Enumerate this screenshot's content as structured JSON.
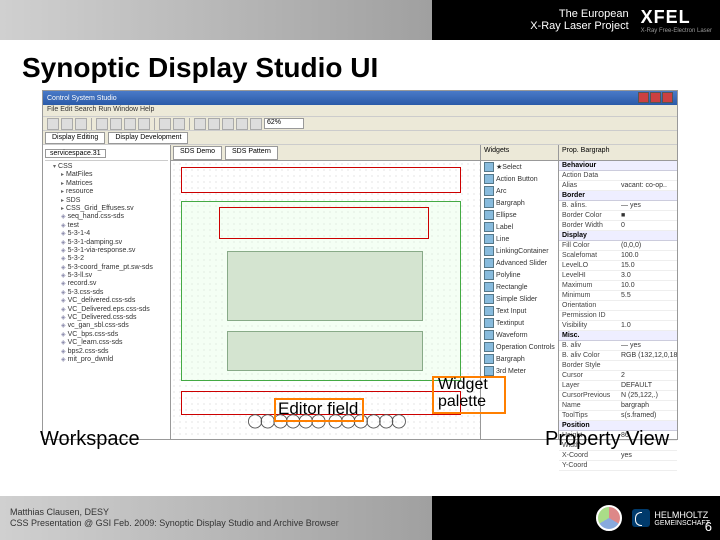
{
  "header": {
    "line1": "The European",
    "line2": "X-Ray Laser Project",
    "brand": "XFEL",
    "brand_sub": "X-Ray Free-Electron Laser"
  },
  "title": "Synoptic Display Studio UI",
  "app": {
    "window_title": "Control System Studio",
    "menu": "File  Edit  Search  Run  Window  Help",
    "zoom": "62%",
    "fs_tab1": "Display Editing",
    "fs_tab2": "Display Development",
    "editor_tab": "servicespace.31",
    "canvas_tab1": "SDS Demo",
    "canvas_tab2": "SDS Pattern"
  },
  "tree": {
    "root": "CSS",
    "items": [
      "MatFiles",
      "Matrices",
      "resource",
      "SDS",
      "CSS_Grid_Effuses.sv",
      "seq_hand.css-sds",
      "test",
      "5-3-1-4",
      "5-3-1-damping.sv",
      "5-3-1-via-response.sv",
      "5-3-2",
      "5-3-coord_frame_pt.sw-sds",
      "5-3-ll.sv",
      "record.sv",
      "5-3.css-sds",
      "VC_delivered.css-sds",
      "VC_Delivered.eps.css-sds",
      "VC_Delivered.css-sds",
      "vc_gan_sbl.css-sds",
      "VC_bps.css-sds",
      "VC_learn.css-sds",
      "bps2.css-sds",
      "mit_pro_dwnld"
    ]
  },
  "palette": {
    "title": "Widgets",
    "items": [
      "★Select",
      "Action Button",
      "Arc",
      "Bargraph",
      "Ellipse",
      "Label",
      "Line",
      "LinkingContainer",
      "Advanced Slider",
      "Polyline",
      "Rectangle",
      "Simple Slider",
      "Text Input",
      "Textinput",
      "Waveform",
      "Operation Controls",
      "Bargraph",
      "3rd Meter"
    ]
  },
  "props": {
    "title": "Prop. Bargraph",
    "sections": {
      "behaviour": [
        [
          "Action Data",
          ""
        ],
        [
          "Alias",
          "vacant: co-op.."
        ]
      ],
      "border": [
        [
          "B. alins.",
          "— yes"
        ],
        [
          "Border Color",
          "■"
        ],
        [
          "Border Width",
          "0"
        ]
      ],
      "display": [
        [
          "Fill Color",
          "(0,0,0)"
        ],
        [
          "Scalefomat",
          "100.0"
        ],
        [
          "LevelLO",
          "15.0"
        ],
        [
          "LevelHI",
          "3.0"
        ],
        [
          "Maximum",
          "10.0"
        ],
        [
          "Minimum",
          "5.5"
        ],
        [
          "Orientation",
          ""
        ],
        [
          "Permission ID",
          ""
        ],
        [
          "Visibility",
          "1.0"
        ]
      ],
      "misc": [
        [
          "B. aliv",
          "— yes"
        ],
        [
          "B. aliv Color",
          "RGB (132,12,0,185)"
        ],
        [
          "Border Style",
          ""
        ],
        [
          "Cursor",
          "2"
        ],
        [
          "Layer",
          "DEFAULT"
        ],
        [
          "CursorPrevious",
          "N (25,122,.)"
        ],
        [
          "Name",
          "bargraph"
        ],
        [
          "ToolTips",
          "s(s.framed)"
        ]
      ],
      "position": [
        [
          "Height",
          "86"
        ],
        [
          "Width",
          ""
        ],
        [
          "X-Coord",
          "yes"
        ],
        [
          "Y-Coord",
          ""
        ]
      ]
    }
  },
  "callouts": {
    "workspace": "Workspace",
    "editor": "Editor field",
    "palette": "Widget\npalette",
    "props": "Property View"
  },
  "footer": {
    "author": "Matthias Clausen, DESY",
    "sub": "CSS Presentation @ GSI Feb. 2009: Synoptic Display Studio and Archive Browser",
    "helm": "HELMHOLTZ",
    "helm2": "GEMEINSCHAFT",
    "page": "6"
  }
}
